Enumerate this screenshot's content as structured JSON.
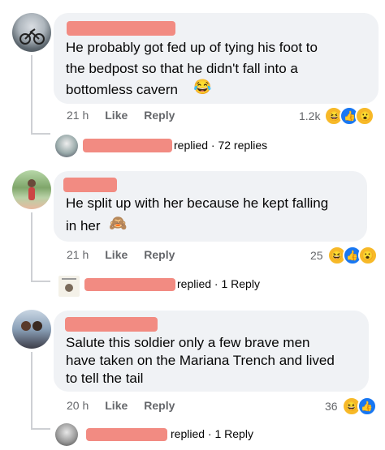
{
  "comments": [
    {
      "text_line1": "He probably got fed up of tying his foot to",
      "text_line2": "the bedpost so that he didn't fall into a",
      "text_line3": "bottomless cavern",
      "emoji": "😂",
      "time": "21 h",
      "like": "Like",
      "reply": "Reply",
      "reaction_count": "1.2k",
      "replied_label": "replied · 72 replies"
    },
    {
      "text_line1": "He split up with her because he kept falling",
      "text_line2": "in her",
      "emoji": "🙈",
      "time": "21 h",
      "like": "Like",
      "reply": "Reply",
      "reaction_count": "25",
      "replied_label": "replied · 1 Reply"
    },
    {
      "text_line1": "Salute this soldier only a few brave men",
      "text_line2": "have taken on the Mariana Trench and lived",
      "text_line3": "to tell the tail",
      "time": "20 h",
      "like": "Like",
      "reply": "Reply",
      "reaction_count": "36",
      "replied_label": "replied · 1 Reply"
    }
  ],
  "reactions": {
    "haha": "😆",
    "like": "👍",
    "wow": "😮"
  },
  "colors": {
    "bubble": "#f0f2f5",
    "redaction": "#f28b82",
    "like_blue": "#1877f2",
    "haha_yellow": "#f7b928",
    "muted_text": "#65676b"
  }
}
